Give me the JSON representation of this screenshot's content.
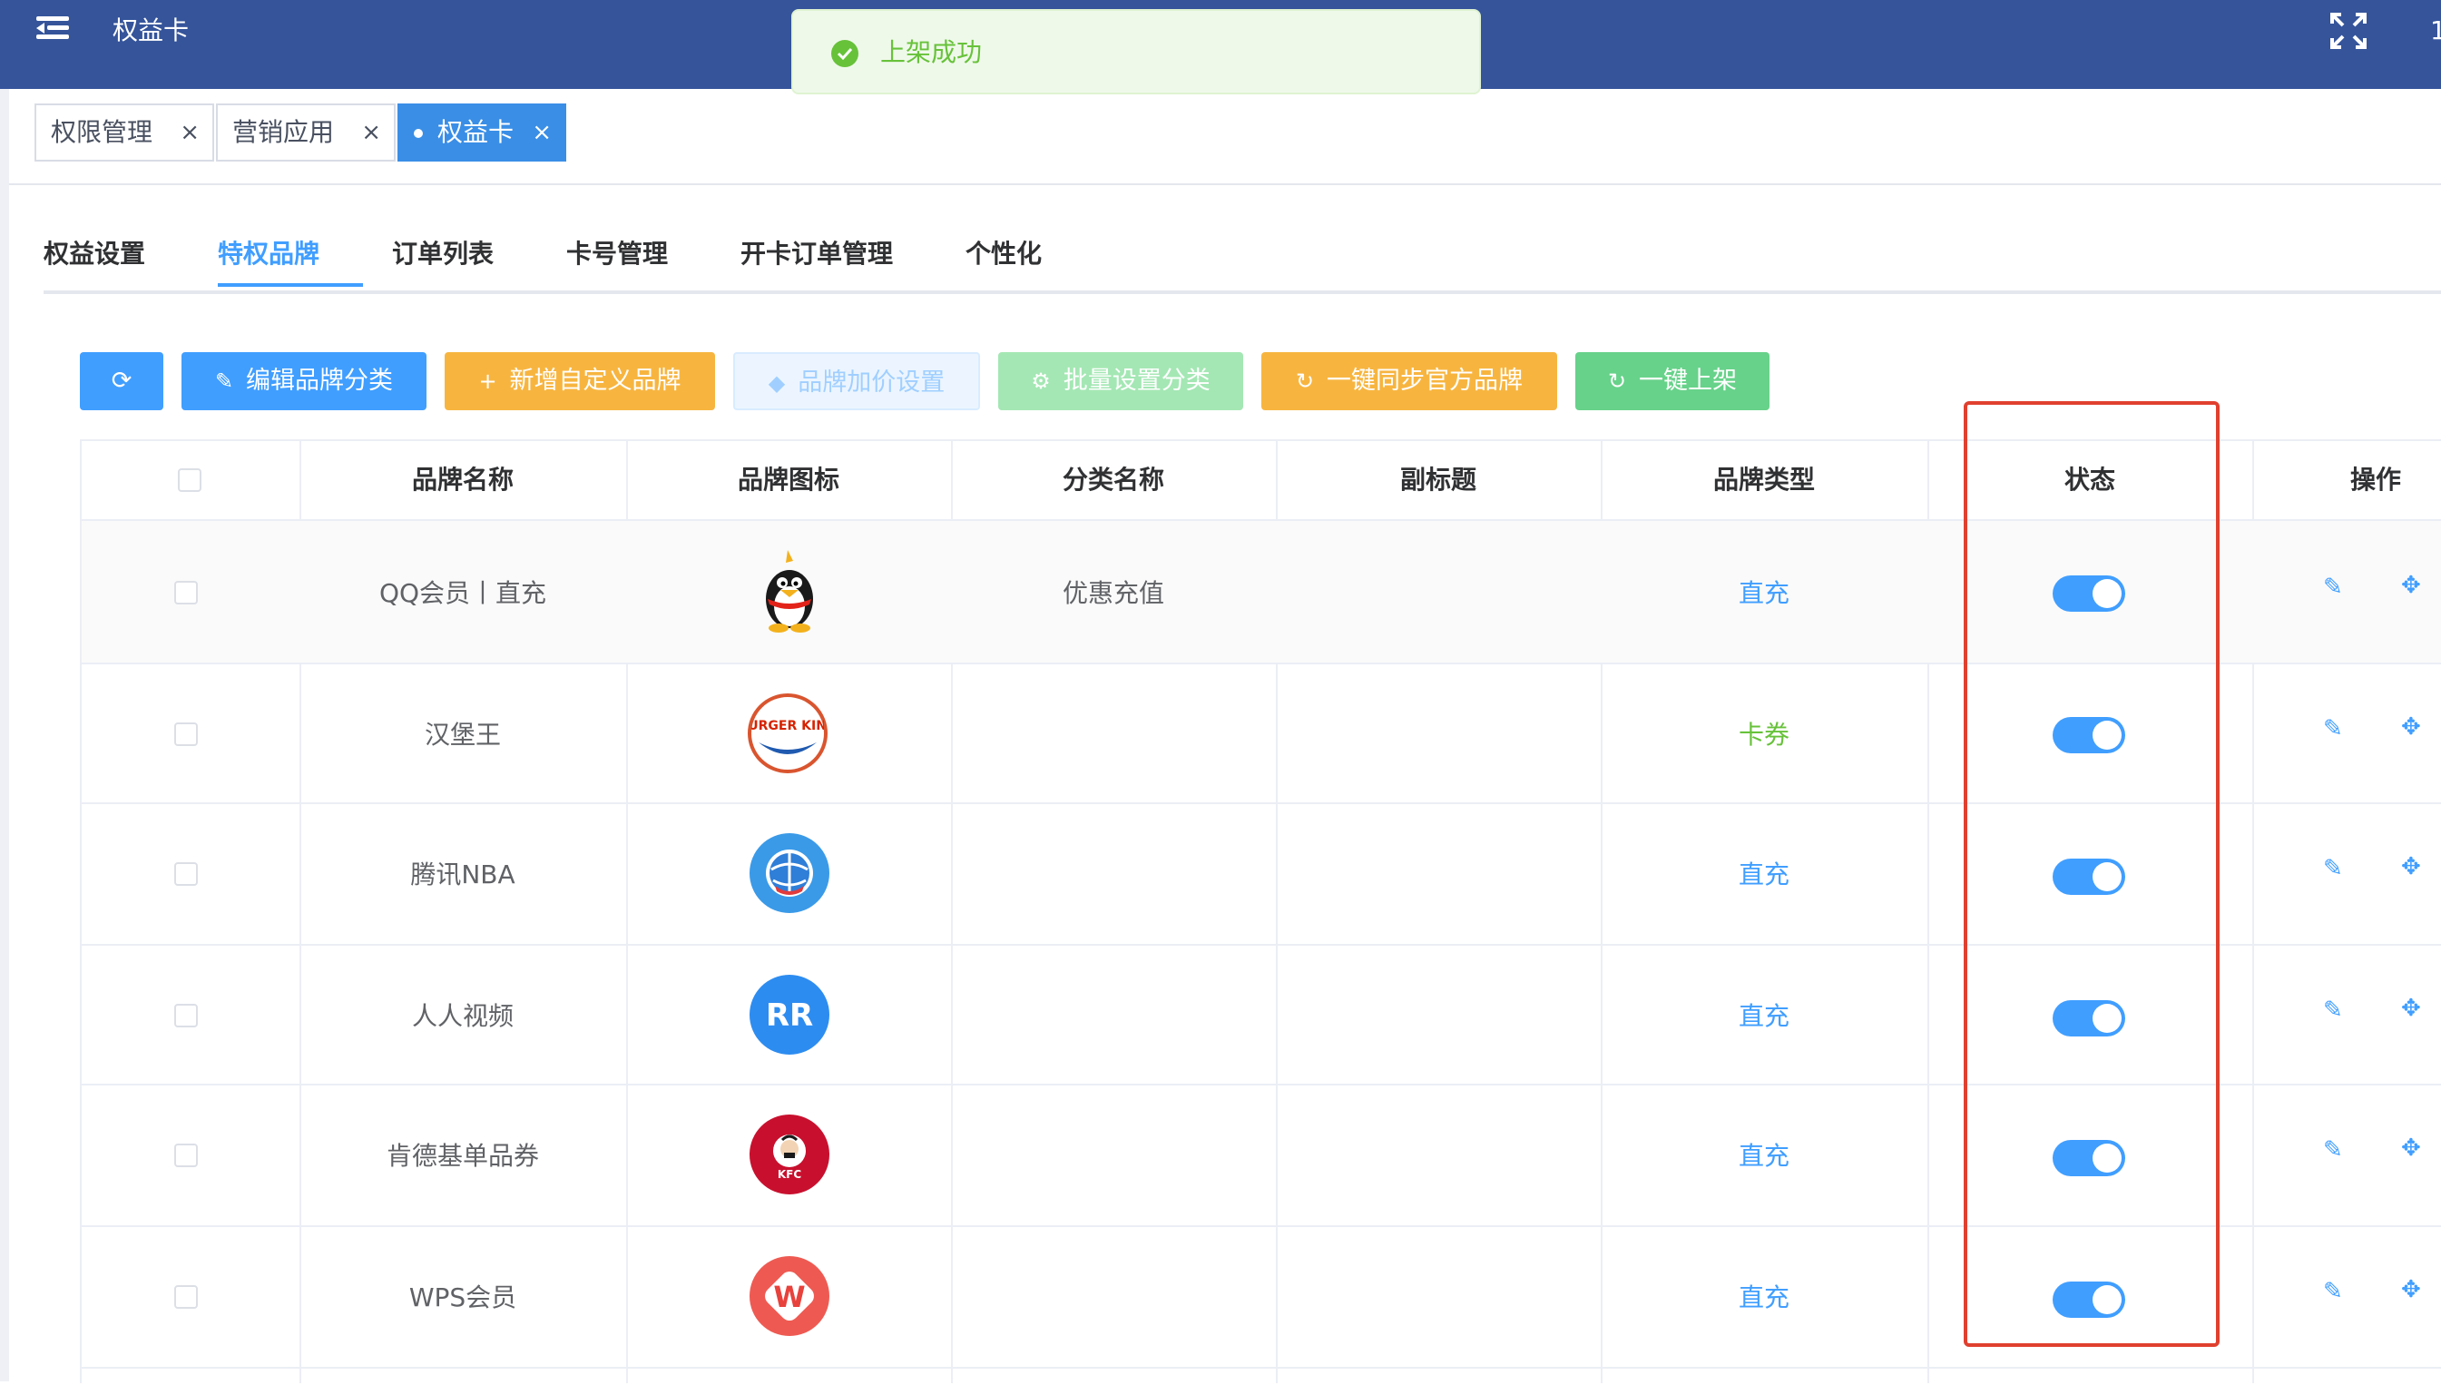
{
  "app": {
    "title": "权益卡",
    "top_right_text": "1"
  },
  "toast": {
    "message": "上架成功",
    "icon": "check-circle-icon",
    "color": "#67c23a"
  },
  "tags": [
    {
      "label": "权限管理"
    },
    {
      "label": "营销应用"
    },
    {
      "label": "权益卡",
      "active": true
    }
  ],
  "tabs": [
    {
      "label": "权益设置"
    },
    {
      "label": "特权品牌",
      "active": true
    },
    {
      "label": "订单列表"
    },
    {
      "label": "卡号管理"
    },
    {
      "label": "开卡订单管理"
    },
    {
      "label": "个性化"
    }
  ],
  "toolbar": {
    "refresh_icon": "refresh-icon",
    "edit_category": "编辑品牌分类",
    "add_custom_brand": "新增自定义品牌",
    "brand_markup": "品牌加价设置",
    "batch_category": "批量设置分类",
    "sync_official": "一键同步官方品牌",
    "publish_all": "一键上架"
  },
  "table": {
    "headers": {
      "brand_name": "品牌名称",
      "brand_icon": "品牌图标",
      "category": "分类名称",
      "subtitle": "副标题",
      "brand_type": "品牌类型",
      "status": "状态",
      "actions": "操作"
    },
    "rows": [
      {
        "name": "QQ会员丨直充",
        "logo": "qq-penguin-logo",
        "category": "优惠充值",
        "subtitle": "",
        "type": "直充",
        "status_on": true
      },
      {
        "name": "汉堡王",
        "logo": "burger-king-logo",
        "logo_text": "BURGER KING",
        "category": "",
        "subtitle": "",
        "type": "卡券",
        "status_on": true
      },
      {
        "name": "腾讯NBA",
        "logo": "tencent-nba-logo",
        "category": "",
        "subtitle": "",
        "type": "直充",
        "status_on": true
      },
      {
        "name": "人人视频",
        "logo": "renren-video-logo",
        "logo_text": "RR",
        "category": "",
        "subtitle": "",
        "type": "直充",
        "status_on": true
      },
      {
        "name": "肯德基单品券",
        "logo": "kfc-logo",
        "logo_text": "KFC",
        "category": "",
        "subtitle": "",
        "type": "直充",
        "status_on": true
      },
      {
        "name": "WPS会员",
        "logo": "wps-logo",
        "logo_text": "W",
        "category": "",
        "subtitle": "",
        "type": "直充",
        "status_on": true
      }
    ]
  },
  "colors": {
    "topbar": "#35549a",
    "primary": "#409eff",
    "highlight_border": "#e0402f"
  }
}
